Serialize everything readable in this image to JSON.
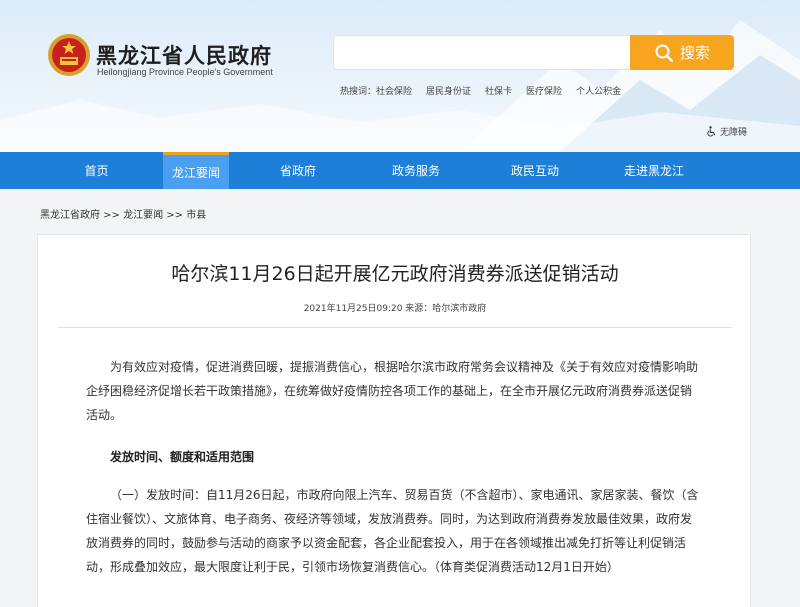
{
  "header": {
    "site_title": "黑龙江省人民政府",
    "site_subtitle": "Heilongjiang Province People's Government",
    "search_button": "搜索",
    "search_placeholder": "",
    "hot_words": [
      "热搜词：社会保险",
      "居民身份证",
      "社保卡",
      "医疗保险",
      "个人公积金"
    ],
    "accessible_label": "无障碍"
  },
  "nav": {
    "items": [
      "首页",
      "龙江要闻",
      "省政府",
      "政务服务",
      "政民互动",
      "走进黑龙江"
    ],
    "active_index": 1
  },
  "breadcrumb": "黑龙江省政府 >> 龙江要闻 >> 市县",
  "article": {
    "title": "哈尔滨11月26日起开展亿元政府消费券派送促销活动",
    "meta": "2021年11月25日09:20 来源：哈尔滨市政府",
    "paragraph1": "为有效应对疫情，促进消费回暖，提振消费信心，根据哈尔滨市政府常务会议精神及《关于有效应对疫情影响助企纾困稳经济促增长若干政策措施》，在统筹做好疫情防控各项工作的基础上，在全市开展亿元政府消费券派送促销活动。",
    "section_heading": "发放时间、额度和适用范围",
    "paragraph2": "（一）发放时间：自11月26日起，市政府向限上汽车、贸易百货（不含超市）、家电通讯、家居家装、餐饮（含住宿业餐饮）、文旅体育、电子商务、夜经济等领域，发放消费券。同时，为达到政府消费券发放最佳效果，政府发放消费券的同时，鼓励参与活动的商家予以资金配套，各企业配套投入，用于在各领域推出减免打折等让利促销活动，形成叠加效应，最大限度让利于民，引领市场恢复消费信心。（体育类促消费活动12月1日开始）"
  },
  "colors": {
    "nav_blue": "#1e7fd8",
    "nav_active": "#4b9ff0",
    "accent_orange": "#f7a41e"
  }
}
